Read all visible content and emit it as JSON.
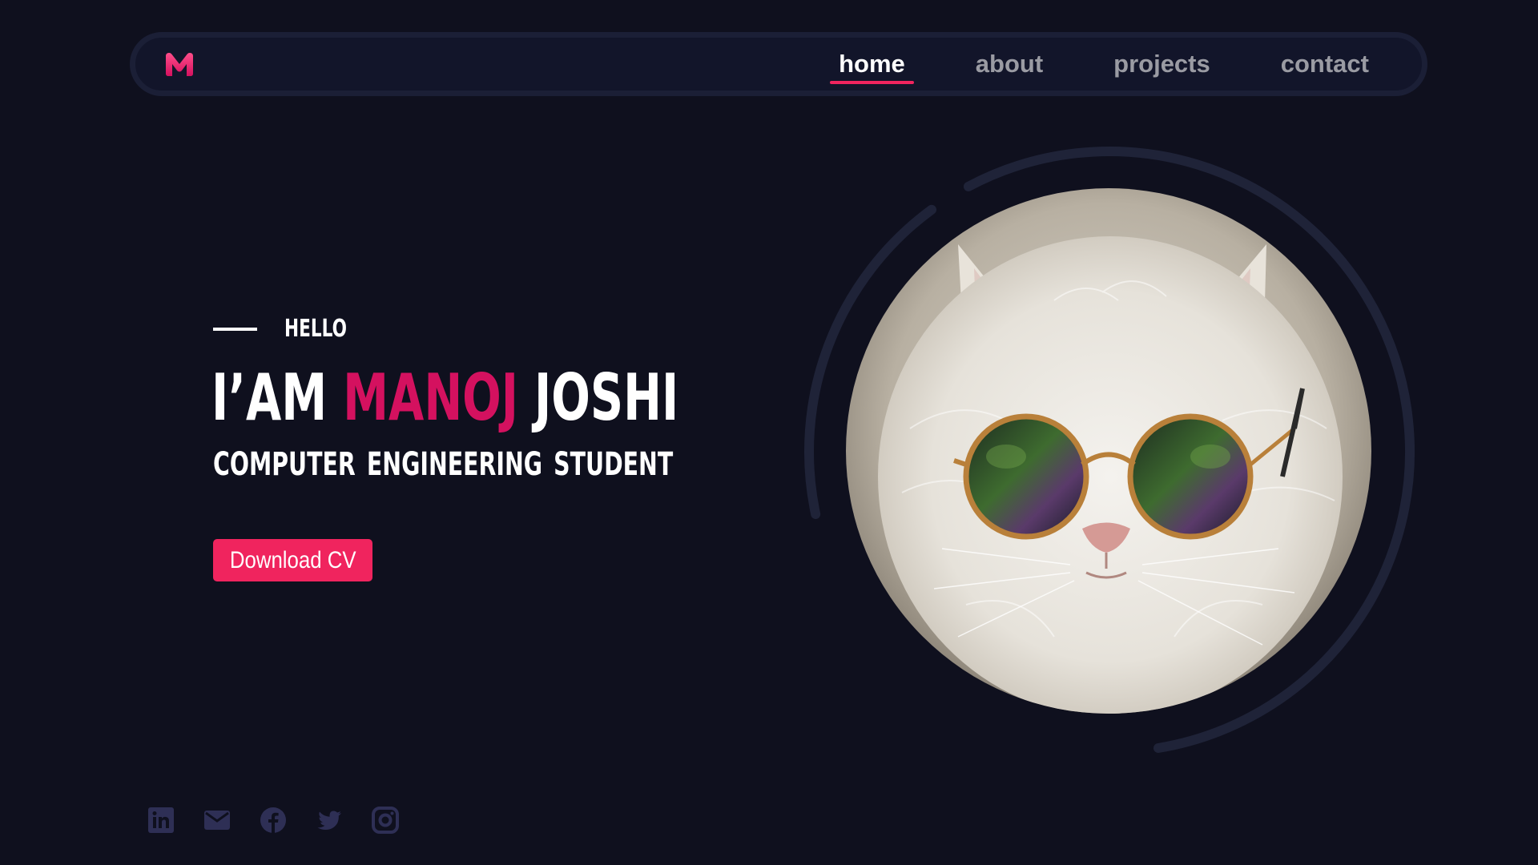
{
  "nav": {
    "logo_icon": "m-logo-icon",
    "links": [
      {
        "label": "home",
        "active": true
      },
      {
        "label": "about",
        "active": false
      },
      {
        "label": "projects",
        "active": false
      },
      {
        "label": "contact",
        "active": false
      }
    ]
  },
  "hero": {
    "greeting": "HELLO",
    "intro": "I’AM",
    "first_name": "MANOJ",
    "last_name": "JOSHI",
    "role": "COMPUTER ENGINEERING STUDENT",
    "cta_label": "Download CV"
  },
  "portrait": {
    "subject_icon": "cat-with-sunglasses-photo"
  },
  "social": [
    {
      "icon": "linkedin-icon"
    },
    {
      "icon": "mail-icon"
    },
    {
      "icon": "facebook-icon"
    },
    {
      "icon": "twitter-icon"
    },
    {
      "icon": "instagram-icon"
    }
  ],
  "colors": {
    "background": "#0f101e",
    "accent": "#f0245e",
    "name_accent": "#d4115f",
    "nav_border": "#1b1f36",
    "muted": "#9a9ba3",
    "icon_color": "#2e2f55"
  }
}
